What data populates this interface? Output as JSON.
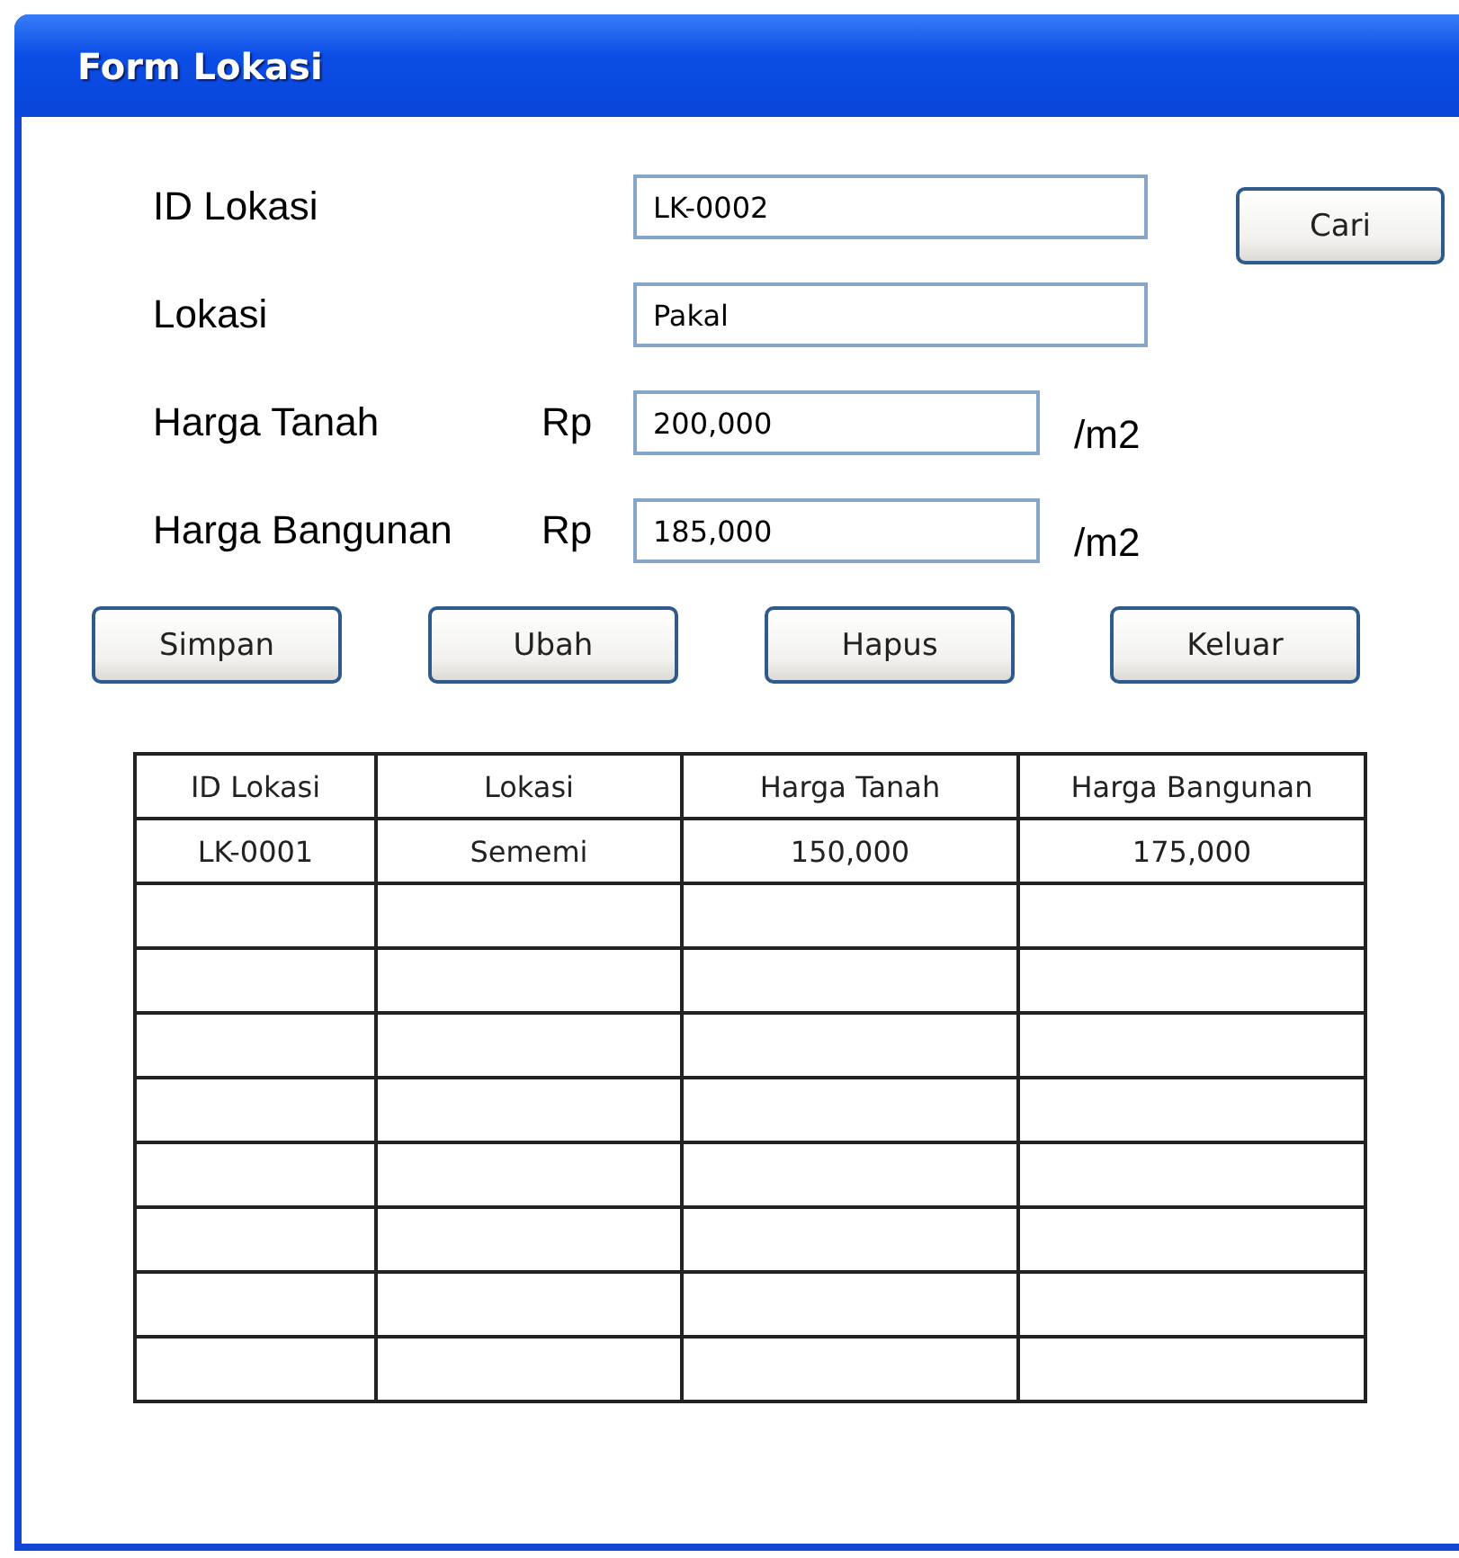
{
  "window": {
    "title": "Form Lokasi"
  },
  "fields": [
    {
      "label": "ID Lokasi",
      "value": "LK-0002"
    },
    {
      "label": "Lokasi",
      "value": "Pakal"
    },
    {
      "label": "Harga Tanah",
      "prefix": "Rp",
      "value": "200,000",
      "suffix": "/m2"
    },
    {
      "label": "Harga Bangunan",
      "prefix": "Rp",
      "value": "185,000",
      "suffix": "/m2"
    }
  ],
  "search_button": "Cari",
  "buttons": [
    "Simpan",
    "Ubah",
    "Hapus",
    "Keluar"
  ],
  "table": {
    "columns": [
      "ID Lokasi",
      "Lokasi",
      "Harga Tanah",
      "Harga Bangunan"
    ],
    "rows": [
      [
        "LK-0001",
        "Sememi",
        "150,000",
        "175,000"
      ]
    ]
  }
}
